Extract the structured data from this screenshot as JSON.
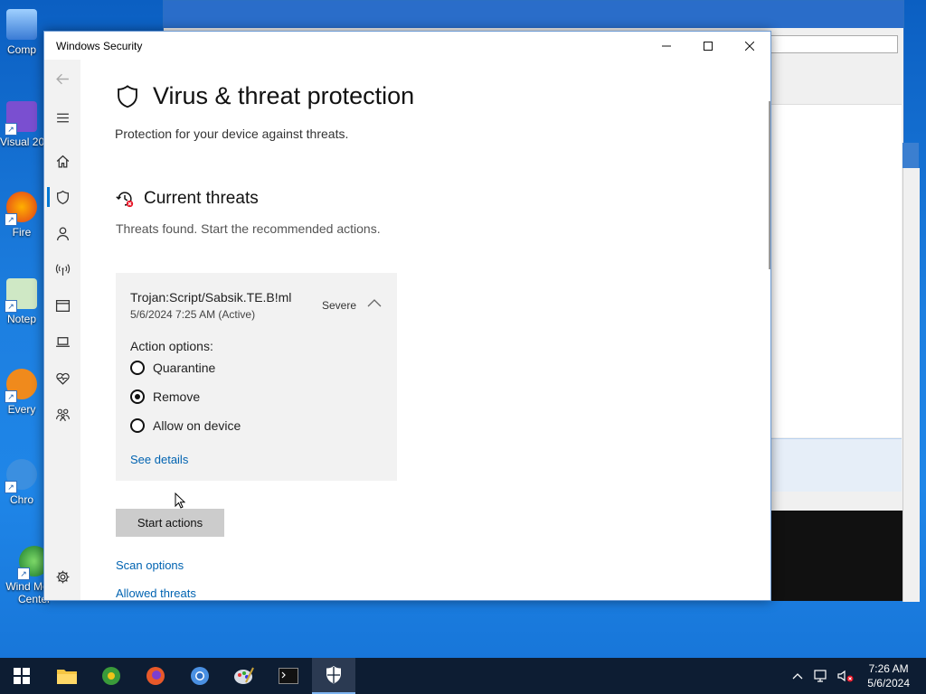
{
  "window": {
    "title": "Windows Security",
    "minimize": "—",
    "maximize": "☐",
    "close": "✕"
  },
  "sidebar": {
    "items": [
      {
        "name": "back",
        "icon": "back-arrow-icon"
      },
      {
        "name": "menu",
        "icon": "hamburger-icon"
      },
      {
        "name": "home",
        "icon": "home-icon"
      },
      {
        "name": "virus-protection",
        "icon": "shield-icon",
        "selected": true
      },
      {
        "name": "account-protection",
        "icon": "person-icon"
      },
      {
        "name": "firewall",
        "icon": "antenna-icon"
      },
      {
        "name": "app-browser-control",
        "icon": "browser-icon"
      },
      {
        "name": "device-security",
        "icon": "laptop-icon"
      },
      {
        "name": "device-performance",
        "icon": "heart-icon"
      },
      {
        "name": "family-options",
        "icon": "family-icon"
      },
      {
        "name": "settings",
        "icon": "gear-icon"
      }
    ]
  },
  "page": {
    "title": "Virus & threat protection",
    "subtitle": "Protection for your device against threats."
  },
  "threats": {
    "heading": "Current threats",
    "summary": "Threats found. Start the recommended actions.",
    "item": {
      "name": "Trojan:Script/Sabsik.TE.B!ml",
      "date": "5/6/2024 7:25 AM (Active)",
      "severity": "Severe",
      "action_label": "Action options:",
      "options": [
        {
          "label": "Quarantine",
          "selected": false
        },
        {
          "label": "Remove",
          "selected": true
        },
        {
          "label": "Allow on device",
          "selected": false
        }
      ],
      "details_link": "See details"
    },
    "start_button": "Start actions",
    "links": [
      "Scan options",
      "Allowed threats"
    ]
  },
  "desktop": {
    "icons": [
      "Comp",
      "Visual 20",
      "Fire",
      "Notep",
      "Every",
      "Chro",
      "Wind Media Center"
    ]
  },
  "taskbar": {
    "time": "7:26 AM",
    "date": "5/6/2024",
    "apps": [
      "start-icon",
      "file-explorer-icon",
      "chrome-old-icon",
      "firefox-icon",
      "chromium-icon",
      "paint-icon",
      "terminal-icon",
      "windows-security-icon"
    ]
  },
  "colors": {
    "accent": "#0078d4",
    "link": "#0063b1",
    "taskbar": "#0d1d33"
  }
}
